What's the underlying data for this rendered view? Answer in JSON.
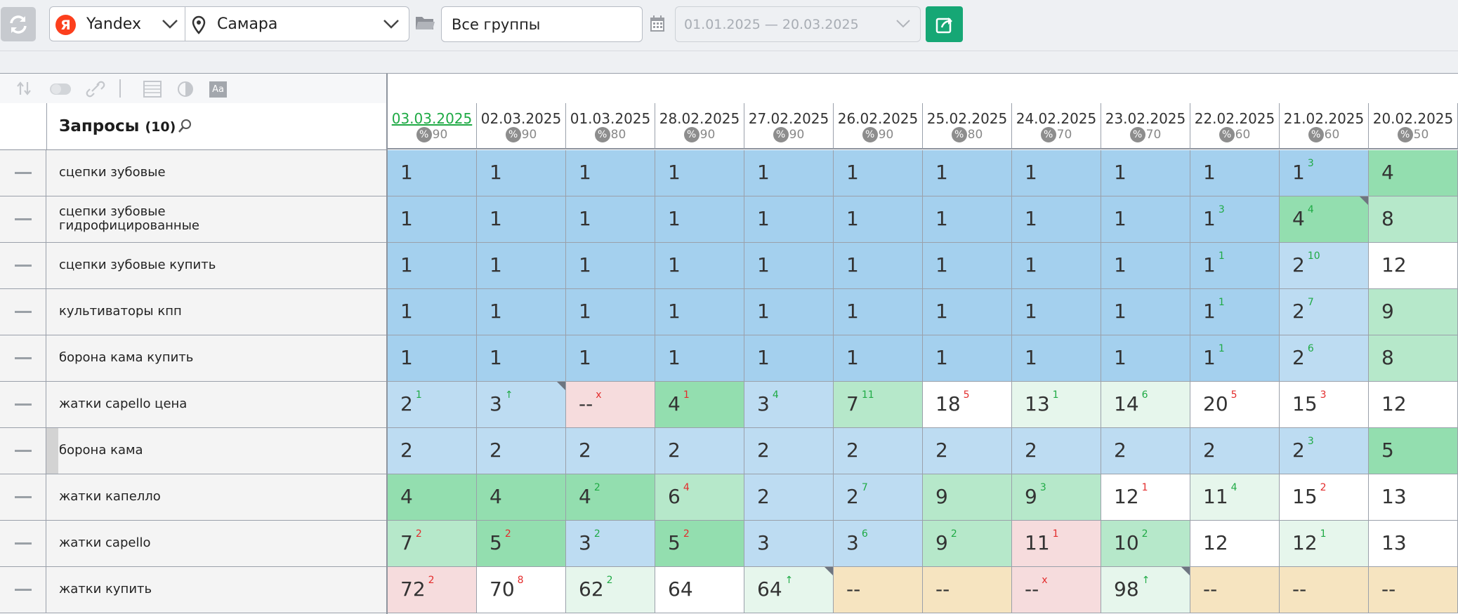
{
  "toolbar": {
    "engine": "Yandex",
    "engine_logo": "Я",
    "city": "Самара",
    "group": "Все группы",
    "date_range": "01.01.2025 — 20.03.2025",
    "icons": [
      "refresh-icon",
      "location-pin-icon",
      "folder-icon",
      "calendar-icon",
      "export-icon"
    ]
  },
  "table_tools": [
    "sort-icon",
    "toggle-icon",
    "link-icon",
    "table-icon",
    "contrast-icon",
    "font-icon"
  ],
  "header": {
    "title": "Запросы",
    "count": "(10)"
  },
  "dates": [
    {
      "label": "03.03.2025",
      "pct": "90",
      "active": true
    },
    {
      "label": "02.03.2025",
      "pct": "90"
    },
    {
      "label": "01.03.2025",
      "pct": "80"
    },
    {
      "label": "28.02.2025",
      "pct": "90"
    },
    {
      "label": "27.02.2025",
      "pct": "90"
    },
    {
      "label": "26.02.2025",
      "pct": "90"
    },
    {
      "label": "25.02.2025",
      "pct": "80"
    },
    {
      "label": "24.02.2025",
      "pct": "70"
    },
    {
      "label": "23.02.2025",
      "pct": "70"
    },
    {
      "label": "22.02.2025",
      "pct": "60"
    },
    {
      "label": "21.02.2025",
      "pct": "60"
    },
    {
      "label": "20.02.2025",
      "pct": "50"
    }
  ],
  "colors": {
    "blue": "#a4d0ee",
    "lblue": "#bddcf2",
    "green": "#93deaf",
    "lgreen": "#b6e8ca",
    "xlgreen": "#e6f6ec",
    "red": "#f6dcdd",
    "white": "#ffffff",
    "tan": "#f6e4c0",
    "delta_up": "#1faa45",
    "delta_down": "#e32c2c",
    "export": "#16a775"
  },
  "rows": [
    {
      "query": [
        "сцепки зубовые"
      ],
      "cells": [
        {
          "v": "1",
          "bg": "blue"
        },
        {
          "v": "1",
          "bg": "blue"
        },
        {
          "v": "1",
          "bg": "blue"
        },
        {
          "v": "1",
          "bg": "blue"
        },
        {
          "v": "1",
          "bg": "blue"
        },
        {
          "v": "1",
          "bg": "blue"
        },
        {
          "v": "1",
          "bg": "blue"
        },
        {
          "v": "1",
          "bg": "blue"
        },
        {
          "v": "1",
          "bg": "blue"
        },
        {
          "v": "1",
          "bg": "blue"
        },
        {
          "v": "1",
          "d": "3",
          "dir": "up",
          "bg": "blue"
        },
        {
          "v": "4",
          "bg": "green"
        }
      ]
    },
    {
      "query": [
        "сцепки зубовые",
        "гидрофицированные"
      ],
      "cells": [
        {
          "v": "1",
          "bg": "blue"
        },
        {
          "v": "1",
          "bg": "blue"
        },
        {
          "v": "1",
          "bg": "blue"
        },
        {
          "v": "1",
          "bg": "blue"
        },
        {
          "v": "1",
          "bg": "blue"
        },
        {
          "v": "1",
          "bg": "blue"
        },
        {
          "v": "1",
          "bg": "blue"
        },
        {
          "v": "1",
          "bg": "blue"
        },
        {
          "v": "1",
          "bg": "blue"
        },
        {
          "v": "1",
          "d": "3",
          "dir": "up",
          "bg": "blue"
        },
        {
          "v": "4",
          "d": "4",
          "dir": "up",
          "bg": "green",
          "corner": true
        },
        {
          "v": "8",
          "bg": "lgreen"
        }
      ]
    },
    {
      "query": [
        "сцепки зубовые купить"
      ],
      "cells": [
        {
          "v": "1",
          "bg": "blue"
        },
        {
          "v": "1",
          "bg": "blue"
        },
        {
          "v": "1",
          "bg": "blue"
        },
        {
          "v": "1",
          "bg": "blue"
        },
        {
          "v": "1",
          "bg": "blue"
        },
        {
          "v": "1",
          "bg": "blue"
        },
        {
          "v": "1",
          "bg": "blue"
        },
        {
          "v": "1",
          "bg": "blue"
        },
        {
          "v": "1",
          "bg": "blue"
        },
        {
          "v": "1",
          "d": "1",
          "dir": "up",
          "bg": "blue"
        },
        {
          "v": "2",
          "d": "10",
          "dir": "up",
          "bg": "lblue"
        },
        {
          "v": "12",
          "bg": "white"
        }
      ]
    },
    {
      "query": [
        "культиваторы кпп"
      ],
      "cells": [
        {
          "v": "1",
          "bg": "blue"
        },
        {
          "v": "1",
          "bg": "blue"
        },
        {
          "v": "1",
          "bg": "blue"
        },
        {
          "v": "1",
          "bg": "blue"
        },
        {
          "v": "1",
          "bg": "blue"
        },
        {
          "v": "1",
          "bg": "blue"
        },
        {
          "v": "1",
          "bg": "blue"
        },
        {
          "v": "1",
          "bg": "blue"
        },
        {
          "v": "1",
          "bg": "blue"
        },
        {
          "v": "1",
          "d": "1",
          "dir": "up",
          "bg": "blue"
        },
        {
          "v": "2",
          "d": "7",
          "dir": "up",
          "bg": "lblue"
        },
        {
          "v": "9",
          "bg": "lgreen"
        }
      ]
    },
    {
      "query": [
        "борона кама купить"
      ],
      "cells": [
        {
          "v": "1",
          "bg": "blue"
        },
        {
          "v": "1",
          "bg": "blue"
        },
        {
          "v": "1",
          "bg": "blue"
        },
        {
          "v": "1",
          "bg": "blue"
        },
        {
          "v": "1",
          "bg": "blue"
        },
        {
          "v": "1",
          "bg": "blue"
        },
        {
          "v": "1",
          "bg": "blue"
        },
        {
          "v": "1",
          "bg": "blue"
        },
        {
          "v": "1",
          "bg": "blue"
        },
        {
          "v": "1",
          "d": "1",
          "dir": "up",
          "bg": "blue"
        },
        {
          "v": "2",
          "d": "6",
          "dir": "up",
          "bg": "lblue"
        },
        {
          "v": "8",
          "bg": "lgreen"
        }
      ]
    },
    {
      "query": [
        "жатки capello цена"
      ],
      "cells": [
        {
          "v": "2",
          "d": "1",
          "dir": "up",
          "bg": "lblue"
        },
        {
          "v": "3",
          "d": "↑",
          "dir": "up",
          "bg": "lblue",
          "corner": true
        },
        {
          "v": "--",
          "d": "x",
          "dir": "down",
          "bg": "red"
        },
        {
          "v": "4",
          "d": "1",
          "dir": "down",
          "bg": "green"
        },
        {
          "v": "3",
          "d": "4",
          "dir": "up",
          "bg": "lblue"
        },
        {
          "v": "7",
          "d": "11",
          "dir": "up",
          "bg": "lgreen"
        },
        {
          "v": "18",
          "d": "5",
          "dir": "down",
          "bg": "white"
        },
        {
          "v": "13",
          "d": "1",
          "dir": "up",
          "bg": "xlgreen"
        },
        {
          "v": "14",
          "d": "6",
          "dir": "up",
          "bg": "xlgreen"
        },
        {
          "v": "20",
          "d": "5",
          "dir": "down",
          "bg": "white"
        },
        {
          "v": "15",
          "d": "3",
          "dir": "down",
          "bg": "white"
        },
        {
          "v": "12",
          "bg": "white"
        }
      ]
    },
    {
      "query": [
        "борона кама"
      ],
      "marker": true,
      "cells": [
        {
          "v": "2",
          "bg": "lblue"
        },
        {
          "v": "2",
          "bg": "lblue"
        },
        {
          "v": "2",
          "bg": "lblue"
        },
        {
          "v": "2",
          "bg": "lblue"
        },
        {
          "v": "2",
          "bg": "lblue"
        },
        {
          "v": "2",
          "bg": "lblue"
        },
        {
          "v": "2",
          "bg": "lblue"
        },
        {
          "v": "2",
          "bg": "lblue"
        },
        {
          "v": "2",
          "bg": "lblue"
        },
        {
          "v": "2",
          "bg": "lblue"
        },
        {
          "v": "2",
          "d": "3",
          "dir": "up",
          "bg": "lblue"
        },
        {
          "v": "5",
          "bg": "green"
        }
      ]
    },
    {
      "query": [
        "жатки капелло"
      ],
      "cells": [
        {
          "v": "4",
          "bg": "green"
        },
        {
          "v": "4",
          "bg": "green"
        },
        {
          "v": "4",
          "d": "2",
          "dir": "up",
          "bg": "green"
        },
        {
          "v": "6",
          "d": "4",
          "dir": "down",
          "bg": "lgreen"
        },
        {
          "v": "2",
          "bg": "lblue"
        },
        {
          "v": "2",
          "d": "7",
          "dir": "up",
          "bg": "lblue"
        },
        {
          "v": "9",
          "bg": "lgreen"
        },
        {
          "v": "9",
          "d": "3",
          "dir": "up",
          "bg": "lgreen"
        },
        {
          "v": "12",
          "d": "1",
          "dir": "down",
          "bg": "white"
        },
        {
          "v": "11",
          "d": "4",
          "dir": "up",
          "bg": "xlgreen"
        },
        {
          "v": "15",
          "d": "2",
          "dir": "down",
          "bg": "white"
        },
        {
          "v": "13",
          "bg": "white"
        }
      ]
    },
    {
      "query": [
        "жатки capello"
      ],
      "cells": [
        {
          "v": "7",
          "d": "2",
          "dir": "down",
          "bg": "lgreen"
        },
        {
          "v": "5",
          "d": "2",
          "dir": "down",
          "bg": "green"
        },
        {
          "v": "3",
          "d": "2",
          "dir": "up",
          "bg": "lblue"
        },
        {
          "v": "5",
          "d": "2",
          "dir": "down",
          "bg": "green"
        },
        {
          "v": "3",
          "bg": "lblue"
        },
        {
          "v": "3",
          "d": "6",
          "dir": "up",
          "bg": "lblue"
        },
        {
          "v": "9",
          "d": "2",
          "dir": "up",
          "bg": "lgreen"
        },
        {
          "v": "11",
          "d": "1",
          "dir": "down",
          "bg": "red"
        },
        {
          "v": "10",
          "d": "2",
          "dir": "up",
          "bg": "lgreen"
        },
        {
          "v": "12",
          "bg": "white"
        },
        {
          "v": "12",
          "d": "1",
          "dir": "up",
          "bg": "xlgreen"
        },
        {
          "v": "13",
          "bg": "white"
        }
      ]
    },
    {
      "query": [
        "жатки купить"
      ],
      "cells": [
        {
          "v": "72",
          "d": "2",
          "dir": "down",
          "bg": "red"
        },
        {
          "v": "70",
          "d": "8",
          "dir": "down",
          "bg": "white"
        },
        {
          "v": "62",
          "d": "2",
          "dir": "up",
          "bg": "xlgreen"
        },
        {
          "v": "64",
          "bg": "white"
        },
        {
          "v": "64",
          "d": "↑",
          "dir": "up",
          "bg": "xlgreen",
          "corner": true
        },
        {
          "v": "--",
          "bg": "tan"
        },
        {
          "v": "--",
          "bg": "tan"
        },
        {
          "v": "--",
          "d": "x",
          "dir": "down",
          "bg": "red"
        },
        {
          "v": "98",
          "d": "↑",
          "dir": "up",
          "bg": "xlgreen",
          "corner": true
        },
        {
          "v": "--",
          "bg": "tan"
        },
        {
          "v": "--",
          "bg": "tan"
        },
        {
          "v": "--",
          "bg": "tan"
        }
      ]
    }
  ]
}
